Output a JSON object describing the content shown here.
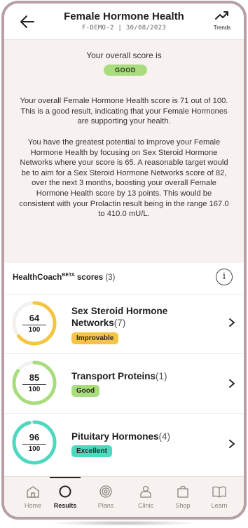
{
  "header": {
    "title": "Female Hormone Health",
    "subtitle": "F-DEMO-2 | 30/08/2023",
    "trends_label": "Trends"
  },
  "summary": {
    "score_label": "Your overall score is",
    "badge": "GOOD",
    "paragraph1": "Your overall Female Hormone Health score is 71 out of 100. This is a good result, indicating that your Female Hormones are supporting your health.",
    "paragraph2": "You have the greatest potential to improve your Female Hormone Health by focusing on Sex Steroid Hormone Networks where your score is 65. A reasonable target would be to aim for a Sex Steroid Hormone Networks score of 82, over the next 3 months, boosting your overall Female Hormone Health score by 13 points. This would be consistent with your Prolactin result being in the range 167.0 to 410.0 mU/L."
  },
  "scores": {
    "heading": "HealthCoach",
    "heading_sup": "BETA",
    "heading_suffix": " scores",
    "count": "(3)",
    "items": [
      {
        "score": "64",
        "max": "100",
        "fraction": 0.64,
        "title": "Sex Steroid Hormone Networks",
        "count": "(7)",
        "status": "Improvable",
        "color": "#f4c542"
      },
      {
        "score": "85",
        "max": "100",
        "fraction": 0.85,
        "title": "Transport Proteins",
        "count": "(1)",
        "status": "Good",
        "color": "#a8dc7c"
      },
      {
        "score": "96",
        "max": "100",
        "fraction": 0.96,
        "title": "Pituitary Hormones",
        "count": "(4)",
        "status": "Excellent",
        "color": "#4fd8c0"
      }
    ]
  },
  "nav": {
    "items": [
      {
        "label": "Home",
        "icon": "home-icon"
      },
      {
        "label": "Results",
        "icon": "results-icon"
      },
      {
        "label": "Plans",
        "icon": "plans-icon"
      },
      {
        "label": "Clinic",
        "icon": "clinic-icon"
      },
      {
        "label": "Shop",
        "icon": "shop-icon"
      },
      {
        "label": "Learn",
        "icon": "learn-icon"
      }
    ],
    "active": "Results"
  }
}
